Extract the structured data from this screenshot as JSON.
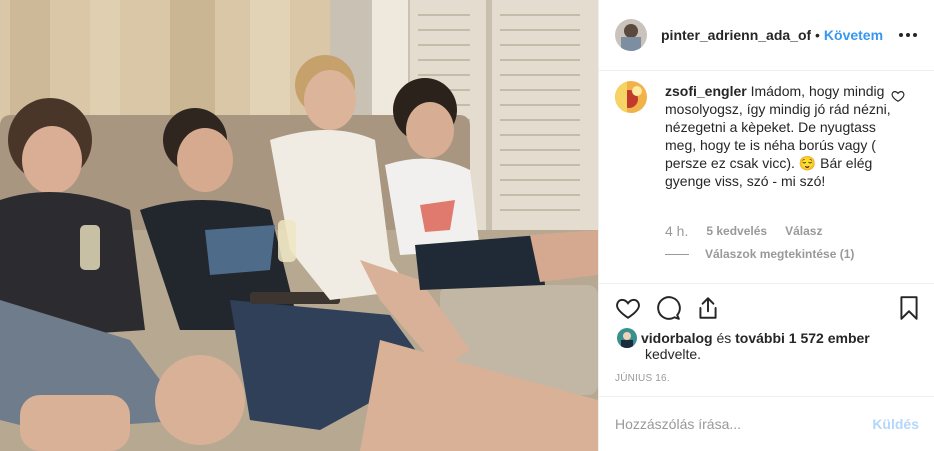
{
  "photo": {
    "description_icon": "photo-image"
  },
  "header": {
    "username": "pinter_adrienn_ada_offi",
    "separator": "•",
    "follow_label": "Követem",
    "more_icon": "more-horizontal-icon"
  },
  "comment": {
    "username": "zsofi_engler",
    "text": "Imádom, hogy mindig mosolyogsz, így mindig jó rád nézni, nézegetni a kèpeket. De nyugtass meg, hogy te is néha borús vagy ( persze ez csak vicc). 😌 Bár elég gyenge viss, szó - mi szó!",
    "time": "4 h.",
    "likes": "5 kedvelés",
    "reply_label": "Válasz",
    "view_replies": "Válaszok megtekintése (1)"
  },
  "actions": {
    "like_icon": "heart-icon",
    "comment_icon": "comment-icon",
    "share_icon": "share-icon",
    "save_icon": "bookmark-icon"
  },
  "likes": {
    "user": "vidorbalog",
    "connector": " és ",
    "others": "további 1 572 ember",
    "suffix": "kedvelte."
  },
  "date": "JÚNIUS 16.",
  "comment_box": {
    "placeholder": "Hozzászólás írása...",
    "send_label": "Küldés"
  },
  "colors": {
    "accent": "#3897f0",
    "send_disabled": "#b3d7fb",
    "muted": "#999999",
    "text": "#262626",
    "divider": "#efefef"
  }
}
